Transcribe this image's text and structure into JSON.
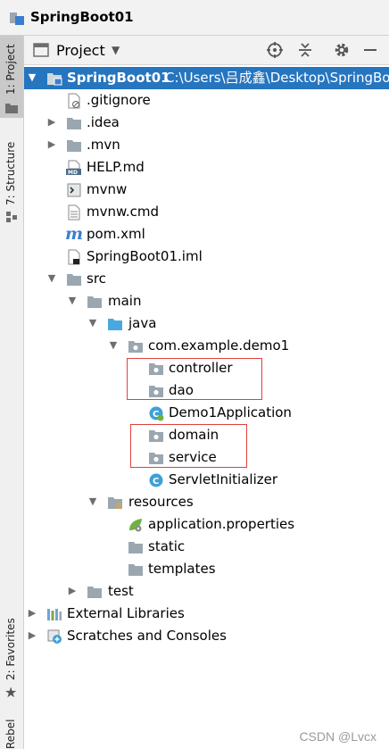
{
  "window": {
    "title": "SpringBoot01"
  },
  "left_strip": {
    "project_tab": "1: Project",
    "structure_tab": "7: Structure",
    "favorites_tab": "2: Favorites",
    "rebel_tab": "Rebel"
  },
  "panel": {
    "title": "Project"
  },
  "tree": {
    "root_label": "SpringBoot01",
    "root_path": "C:\\Users\\吕成鑫\\Desktop\\SpringBo",
    "gitignore": ".gitignore",
    "idea": ".idea",
    "mvn": ".mvn",
    "help": "HELP.md",
    "mvnw": "mvnw",
    "mvnw_cmd": "mvnw.cmd",
    "pom": "pom.xml",
    "iml": "SpringBoot01.iml",
    "src": "src",
    "main": "main",
    "java": "java",
    "package": "com.example.demo1",
    "controller": "controller",
    "dao": "dao",
    "demo_app": "Demo1Application",
    "domain": "domain",
    "service": "service",
    "servlet_init": "ServletInitializer",
    "resources": "resources",
    "app_props": "application.properties",
    "static": "static",
    "templates": "templates",
    "test": "test",
    "external_libs": "External Libraries",
    "scratches": "Scratches and Consoles"
  },
  "watermark": "CSDN @Lvcx",
  "colors": {
    "selection": "#2675bf",
    "highlight_box": "#e0413d",
    "folder": "#9aa7b0",
    "java_folder": "#4aa8e0"
  }
}
